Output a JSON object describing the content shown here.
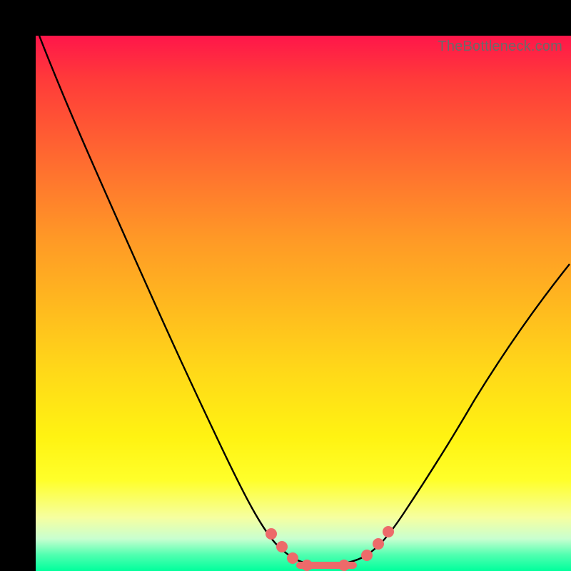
{
  "watermark": "TheBottleneck.com",
  "colors": {
    "frame": "#000000",
    "curve": "#000000",
    "marker": "#ed6a6a",
    "gradient_stops": [
      "#ff164a",
      "#ff3a3a",
      "#ff5a33",
      "#ff7a2d",
      "#ff9926",
      "#ffb81f",
      "#ffd719",
      "#fff312",
      "#ffff2a",
      "#f6ffa0",
      "#c8ffd0",
      "#50ffb0",
      "#00ff9c"
    ]
  },
  "chart_data": {
    "type": "line",
    "title": "",
    "xlabel": "",
    "ylabel": "",
    "x": [
      0.0,
      0.05,
      0.1,
      0.15,
      0.2,
      0.25,
      0.3,
      0.35,
      0.4,
      0.45,
      0.48,
      0.5,
      0.52,
      0.55,
      0.58,
      0.6,
      0.63,
      0.68,
      0.73,
      0.78,
      0.85,
      0.92,
      1.0
    ],
    "values": [
      1.0,
      0.88,
      0.76,
      0.64,
      0.52,
      0.42,
      0.33,
      0.25,
      0.17,
      0.1,
      0.06,
      0.03,
      0.01,
      0.0,
      0.0,
      0.0,
      0.01,
      0.03,
      0.08,
      0.15,
      0.26,
      0.38,
      0.52
    ],
    "xlim": [
      0,
      1
    ],
    "ylim": [
      0,
      1
    ],
    "markers": {
      "points_x": [
        0.45,
        0.47,
        0.49,
        0.63,
        0.65,
        0.67,
        0.5,
        0.57
      ],
      "points_y": [
        0.09,
        0.06,
        0.04,
        0.01,
        0.03,
        0.05,
        0.02,
        0.0
      ],
      "flat_segment_x": [
        0.5,
        0.6
      ],
      "flat_segment_y": 0.0
    }
  }
}
